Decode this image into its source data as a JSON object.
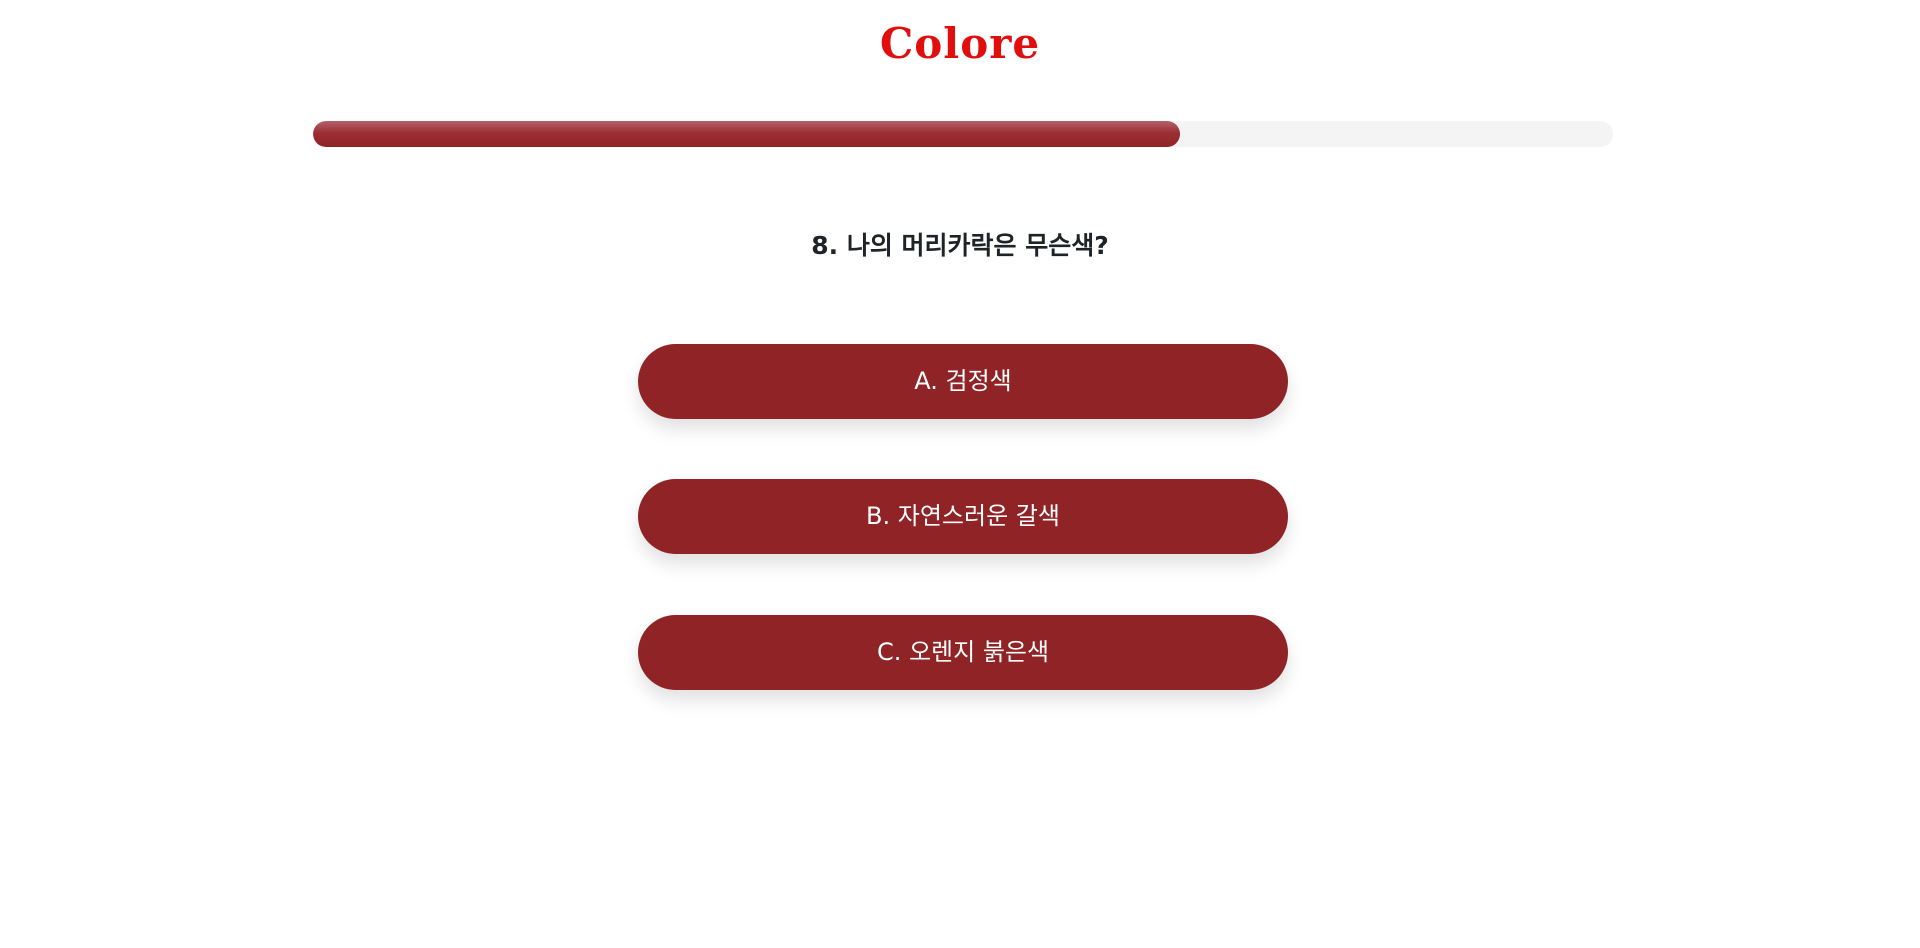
{
  "header": {
    "logo_text": "Colore"
  },
  "progress": {
    "value": 0.667
  },
  "question": {
    "text": "8. 나의 머리카락은 무슨색?"
  },
  "answers": [
    {
      "label": "A. 검정색"
    },
    {
      "label": "B. 자연스러운 갈색"
    },
    {
      "label": "C. 오렌지 붉은색"
    }
  ],
  "colors": {
    "logo": "#e20e0e",
    "button": "#8f2326",
    "progress_fill": "#9c2f35",
    "progress_track": "#f4f4f4",
    "question_text": "#1e2328"
  }
}
